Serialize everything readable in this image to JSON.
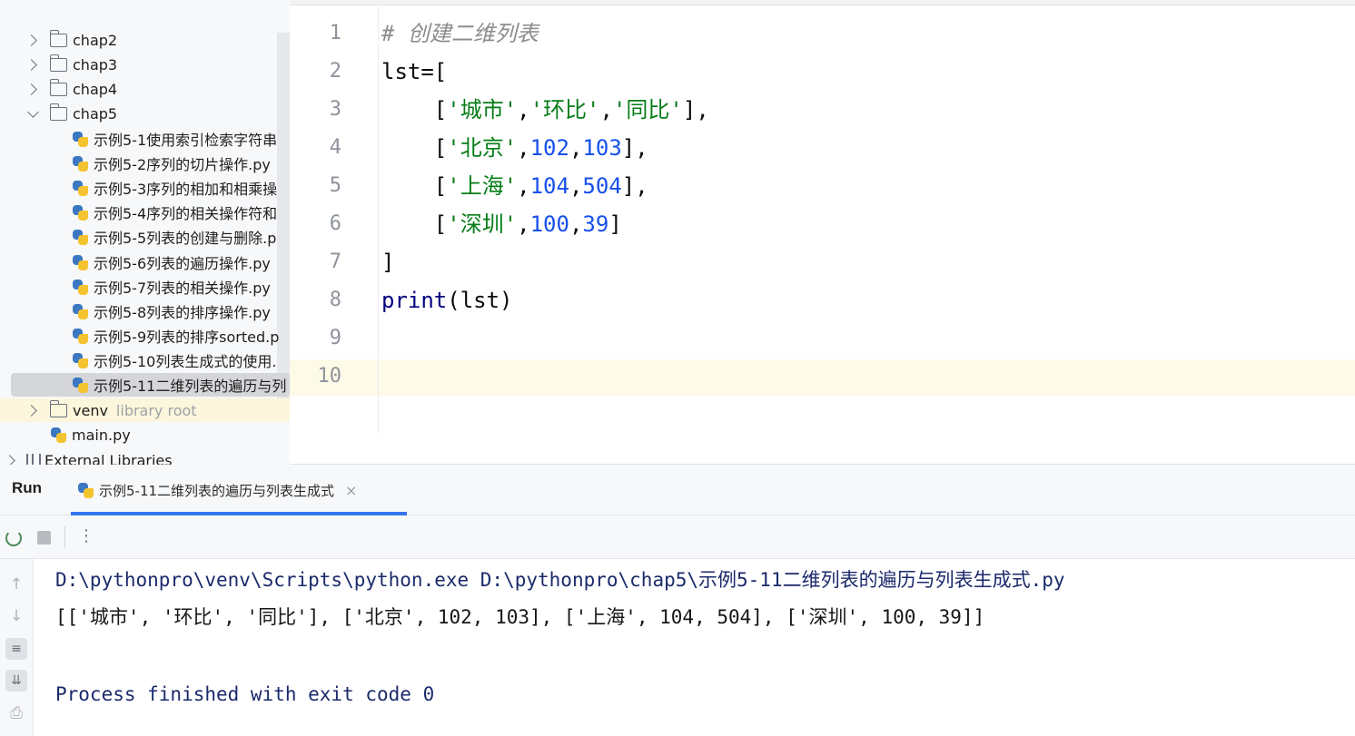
{
  "project_tree": {
    "items": [
      {
        "label": "chap2",
        "kind": "folder",
        "expanded": false
      },
      {
        "label": "chap3",
        "kind": "folder",
        "expanded": false
      },
      {
        "label": "chap4",
        "kind": "folder",
        "expanded": false
      },
      {
        "label": "chap5",
        "kind": "folder",
        "expanded": true
      },
      {
        "label": "示例5-1使用索引检索字符串",
        "kind": "py"
      },
      {
        "label": "示例5-2序列的切片操作.py",
        "kind": "py"
      },
      {
        "label": "示例5-3序列的相加和相乘操",
        "kind": "py"
      },
      {
        "label": "示例5-4序列的相关操作符和",
        "kind": "py"
      },
      {
        "label": "示例5-5列表的创建与删除.p",
        "kind": "py"
      },
      {
        "label": "示例5-6列表的遍历操作.py",
        "kind": "py"
      },
      {
        "label": "示例5-7列表的相关操作.py",
        "kind": "py"
      },
      {
        "label": "示例5-8列表的排序操作.py",
        "kind": "py"
      },
      {
        "label": "示例5-9列表的排序sorted.p",
        "kind": "py"
      },
      {
        "label": "示例5-10列表生成式的使用.",
        "kind": "py"
      },
      {
        "label": "示例5-11二维列表的遍历与列",
        "kind": "py",
        "selected": true
      }
    ],
    "venv": {
      "label": "venv",
      "note": "library root"
    },
    "main_file": "main.py",
    "external": "External Libraries"
  },
  "editor": {
    "line_numbers": [
      "1",
      "2",
      "3",
      "4",
      "5",
      "6",
      "7",
      "8",
      "9",
      "10"
    ],
    "lines": {
      "l1_comment": "# 创建二维列表",
      "l2_code": "lst=[",
      "l3_bracket_open": "    [",
      "l3_s1": "'城市'",
      "l3_sep1": ",",
      "l3_s2": "'环比'",
      "l3_sep2": ",",
      "l3_s3": "'同比'",
      "l3_close": "],",
      "l4_open": "    [",
      "l4_s1": "'北京'",
      "l4_sep1": ",",
      "l4_n1": "102",
      "l4_sep2": ",",
      "l4_n2": "103",
      "l4_close": "],",
      "l5_open": "    [",
      "l5_s1": "'上海'",
      "l5_sep1": ",",
      "l5_n1": "104",
      "l5_sep2": ",",
      "l5_n2": "504",
      "l5_close": "],",
      "l6_open": "    [",
      "l6_s1": "'深圳'",
      "l6_sep1": ",",
      "l6_n1": "100",
      "l6_sep2": ",",
      "l6_n2": "39",
      "l6_close": "]",
      "l7_code": "]",
      "l8_fn": "print",
      "l8_args": "(lst)"
    }
  },
  "run_panel": {
    "title": "Run",
    "tab_label": "示例5-11二维列表的遍历与列表生成式",
    "tab_close": "×",
    "more": "⋮",
    "side_icons": [
      "↑",
      "↓",
      "≡",
      "⇊",
      "⎙"
    ],
    "output": [
      "D:\\pythonpro\\venv\\Scripts\\python.exe D:\\pythonpro\\chap5\\示例5-11二维列表的遍历与列表生成式.py",
      "[['城市', '环比', '同比'], ['北京', 102, 103], ['上海', 104, 504], ['深圳', 100, 39]]",
      "",
      "Process finished with exit code 0"
    ]
  }
}
